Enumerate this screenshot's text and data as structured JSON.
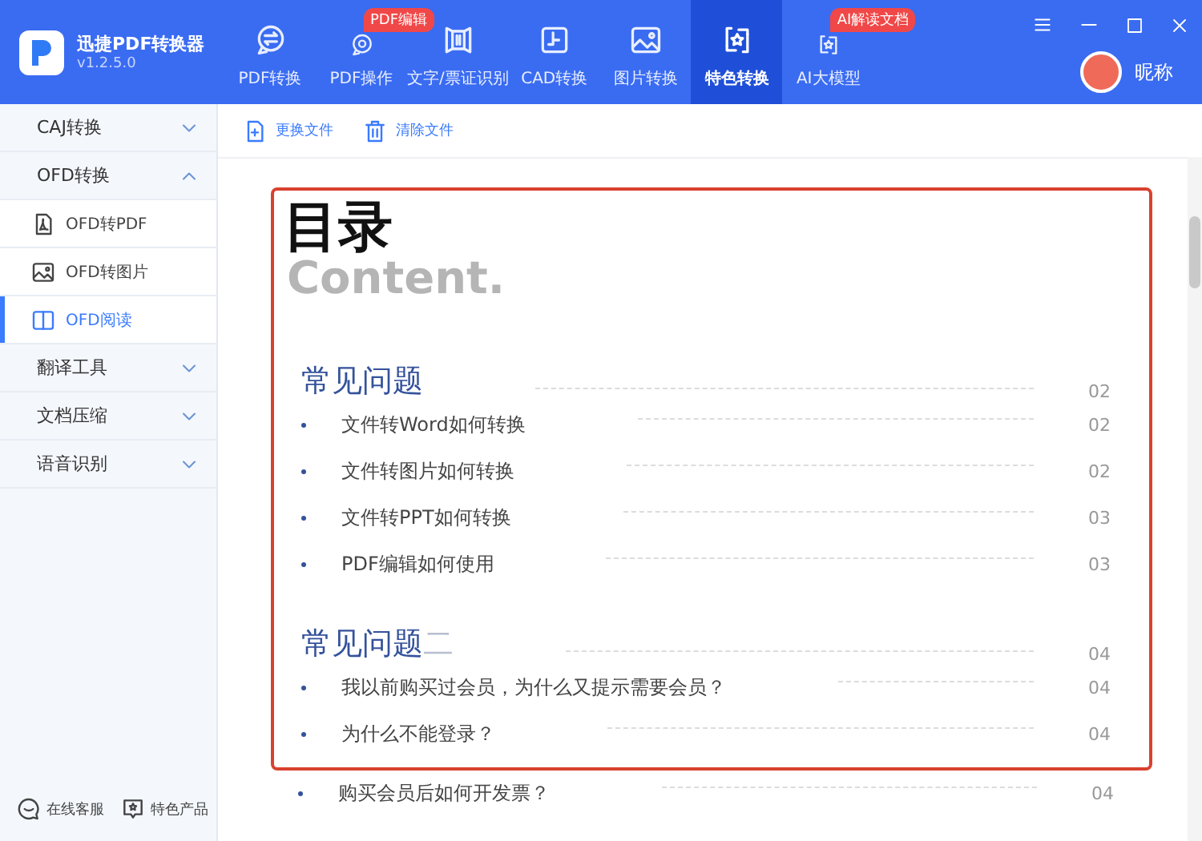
{
  "app": {
    "name": "迅捷PDF转换器",
    "version": "v1.2.5.0"
  },
  "nav": [
    {
      "label": "PDF转换",
      "selected": false
    },
    {
      "label": "PDF操作",
      "selected": false,
      "badge": "PDF编辑"
    },
    {
      "label": "文字/票证识别",
      "selected": false
    },
    {
      "label": "CAD转换",
      "selected": false
    },
    {
      "label": "图片转换",
      "selected": false
    },
    {
      "label": "特色转换",
      "selected": true
    },
    {
      "label": "AI大模型",
      "selected": false,
      "badge": "AI解读文档"
    }
  ],
  "user": {
    "name": "昵称"
  },
  "sidebar": [
    {
      "label": "CAJ转换",
      "expanded": false
    },
    {
      "label": "OFD转换",
      "expanded": true,
      "children": [
        {
          "label": "OFD转PDF",
          "selected": false
        },
        {
          "label": "OFD转图片",
          "selected": false
        },
        {
          "label": "OFD阅读",
          "selected": true
        }
      ]
    },
    {
      "label": "翻译工具",
      "expanded": false
    },
    {
      "label": "文档压缩",
      "expanded": false
    },
    {
      "label": "语音识别",
      "expanded": false
    }
  ],
  "sidebar_footer": [
    {
      "label": "在线客服"
    },
    {
      "label": "特色产品"
    }
  ],
  "toolbar": [
    {
      "label": "更换文件"
    },
    {
      "label": "清除文件"
    }
  ],
  "document": {
    "title": "目录",
    "subtitle": "Content.",
    "sections": [
      {
        "title": "常见问题",
        "page": "02",
        "items": [
          {
            "text": "文件转Word如何转换",
            "page": "02"
          },
          {
            "text": "文件转图片如何转换",
            "page": "02"
          },
          {
            "text": "文件转PPT如何转换",
            "page": "03"
          },
          {
            "text": "PDF编辑如何使用",
            "page": "03"
          }
        ]
      },
      {
        "title": "常见问题",
        "suffix": "二",
        "page": "04",
        "items": [
          {
            "text": "我以前购买过会员，为什么又提示需要会员？",
            "page": "04"
          },
          {
            "text": "为什么不能登录？",
            "page": "04"
          }
        ]
      }
    ],
    "after_box": [
      {
        "text": "购买会员后如何开发票？",
        "page": "04"
      }
    ]
  }
}
